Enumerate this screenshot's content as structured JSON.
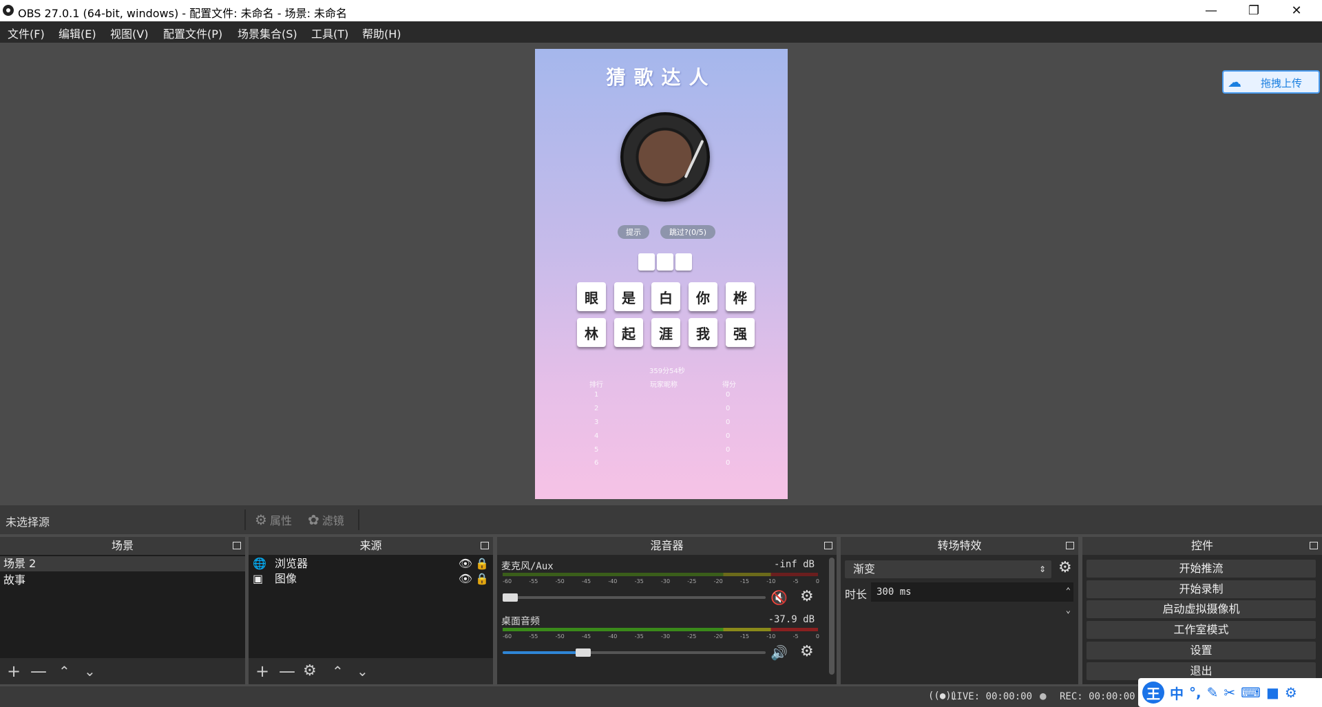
{
  "window": {
    "title": "OBS 27.0.1 (64-bit, windows) - 配置文件: 未命名 - 场景: 未命名"
  },
  "menu": [
    "文件(F)",
    "编辑(E)",
    "视图(V)",
    "配置文件(P)",
    "场景集合(S)",
    "工具(T)",
    "帮助(H)"
  ],
  "preview": {
    "game_title": "猜歌达人",
    "hint_button": "提示",
    "skip_button": "跳过?(0/5)",
    "tiles_row1": [
      "眼",
      "是",
      "白",
      "你",
      "桦"
    ],
    "tiles_row2": [
      "林",
      "起",
      "涯",
      "我",
      "强"
    ],
    "timer": "359分54秒",
    "rank_headers": [
      "排行",
      "玩家昵称",
      "得分"
    ],
    "ranks": [
      "1",
      "2",
      "3",
      "4",
      "5",
      "6"
    ],
    "scores": [
      "0",
      "0",
      "0",
      "0",
      "0",
      "0"
    ]
  },
  "upload": {
    "label": "拖拽上传"
  },
  "toolbar": {
    "no_source": "未选择源",
    "properties": "属性",
    "filters": "滤镜"
  },
  "scenes": {
    "title": "场景",
    "items": [
      "场景 2",
      "故事"
    ]
  },
  "sources": {
    "title": "来源",
    "items": [
      "浏览器",
      "图像"
    ]
  },
  "mixer": {
    "title": "混音器",
    "channels": [
      {
        "name": "麦克风/Aux",
        "level": "-inf dB",
        "muted": true,
        "volume": 0.0
      },
      {
        "name": "桌面音频",
        "level": "-37.9 dB",
        "muted": false,
        "volume": 0.3
      }
    ],
    "scale": [
      "-60",
      "-55",
      "-50",
      "-45",
      "-40",
      "-35",
      "-30",
      "-25",
      "-20",
      "-15",
      "-10",
      "-5",
      "0"
    ]
  },
  "transitions": {
    "title": "转场特效",
    "type": "渐变",
    "duration_label": "时长",
    "duration_value": "300 ms"
  },
  "controls": {
    "title": "控件",
    "buttons": [
      "开始推流",
      "开始录制",
      "启动虚拟摄像机",
      "工作室模式",
      "设置",
      "退出"
    ]
  },
  "status": {
    "live": "LIVE: 00:00:00",
    "rec": "REC: 00:00:00"
  },
  "ime": {
    "label_wang": "王",
    "label_zhong": "中"
  }
}
